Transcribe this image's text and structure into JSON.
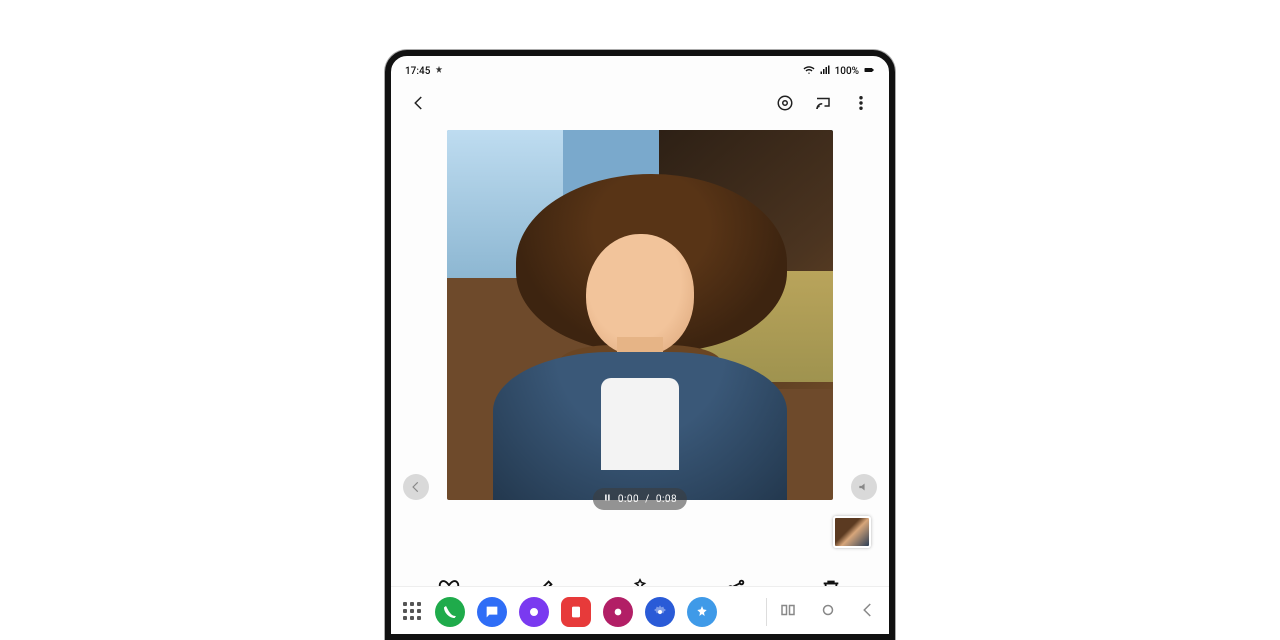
{
  "status": {
    "time": "17:45",
    "battery_text": "100%"
  },
  "playback": {
    "current": "0:00",
    "total": "0:08"
  },
  "dock": {
    "apps": [
      {
        "name": "phone",
        "color": "#1fab4b"
      },
      {
        "name": "messages",
        "color": "#2f6df6"
      },
      {
        "name": "browser",
        "color": "#7a3af0"
      },
      {
        "name": "notes",
        "color": "#e73a3a"
      },
      {
        "name": "camera",
        "color": "#b21f66"
      },
      {
        "name": "settings",
        "color": "#2a5bd7"
      },
      {
        "name": "gallery",
        "color": "#3f9ae8"
      }
    ]
  }
}
